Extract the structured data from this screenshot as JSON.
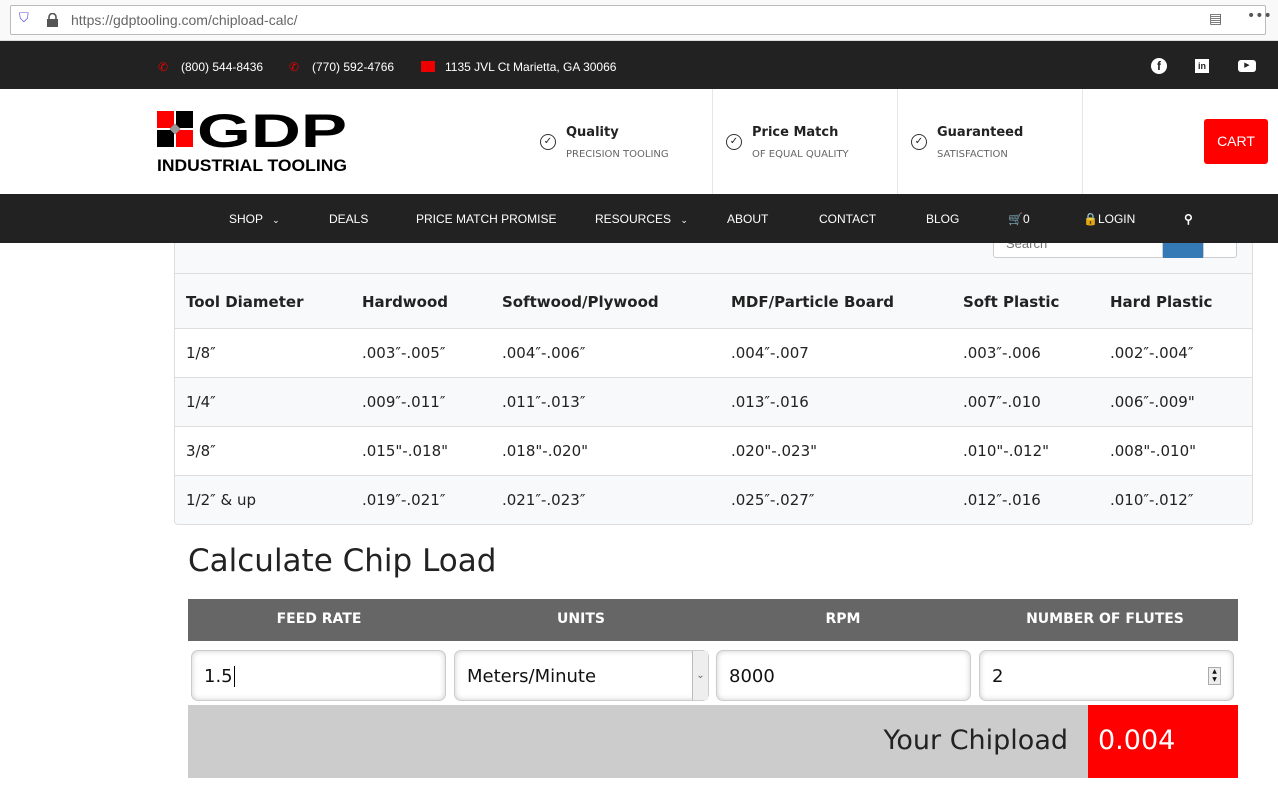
{
  "browser": {
    "url_host": "https://gdptooling.com",
    "url_path": "/chipload-calc/"
  },
  "topbar": {
    "phone1": "(800) 544-8436",
    "phone2": "(770) 592-4766",
    "address": "1135 JVL Ct Marietta, GA 30066",
    "social": [
      "facebook-icon",
      "linkedin-icon",
      "youtube-icon"
    ]
  },
  "logo": {
    "text": "GDP",
    "subtitle": "INDUSTRIAL TOOLING"
  },
  "features": [
    {
      "title": "Quality",
      "subtitle": "PRECISION TOOLING"
    },
    {
      "title": "Price Match",
      "subtitle": "OF EQUAL QUALITY"
    },
    {
      "title": "Guaranteed",
      "subtitle": "SATISFACTION"
    }
  ],
  "cart_label": "CART",
  "nav": {
    "shop": "SHOP",
    "deals": "DEALS",
    "price_match": "PRICE MATCH PROMISE",
    "resources": "RESOURCES",
    "about": "ABOUT",
    "contact": "CONTACT",
    "blog": "BLOG",
    "cart_count": "0",
    "login": "LOGIN"
  },
  "search": {
    "placeholder": "Search"
  },
  "table": {
    "headers": [
      "Tool Diameter",
      "Hardwood",
      "Softwood/Plywood",
      "MDF/Particle Board",
      "Soft Plastic",
      "Hard Plastic"
    ],
    "rows": [
      [
        "1/8″",
        ".003″-.005″",
        ".004″-.006″",
        ".004″-.007",
        ".003″-.006",
        ".002″-.004″"
      ],
      [
        "1/4″",
        ".009″-.011″",
        ".011″-.013″",
        ".013″-.016",
        ".007″-.010",
        ".006″-.009\""
      ],
      [
        "3/8″",
        ".015\"-.018\"",
        ".018\"-.020\"",
        ".020\"-.023\"",
        ".010\"-.012\"",
        ".008\"-.010\""
      ],
      [
        "1/2″ & up",
        ".019″-.021″",
        ".021″-.023″",
        ".025″-.027″",
        ".012″-.016",
        ".010″-.012″"
      ]
    ]
  },
  "calc": {
    "title": "Calculate Chip Load",
    "headers": [
      "FEED RATE",
      "UNITS",
      "RPM",
      "NUMBER OF FLUTES"
    ],
    "feed_rate": "1.5",
    "units": "Meters/Minute",
    "rpm": "8000",
    "flutes": "2",
    "result_label": "Your Chipload",
    "result_value": "0.004"
  },
  "colors": {
    "accent": "#ff0000",
    "dark": "#222222",
    "header_gray": "#666666",
    "result_gray": "#cccccc"
  }
}
